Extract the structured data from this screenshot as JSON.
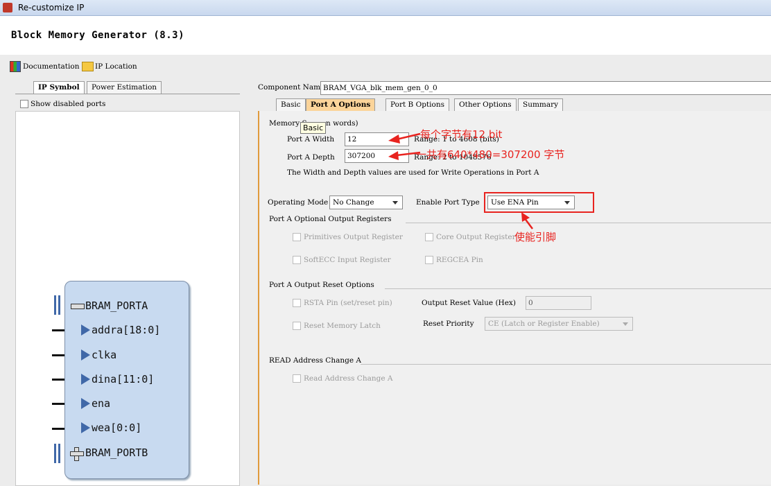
{
  "window": {
    "title": "Re-customize IP"
  },
  "header": {
    "product": "Block Memory Generator (8.3)"
  },
  "links": {
    "documentation": "Documentation",
    "ip_location": "IP Location"
  },
  "left_tabs": [
    "IP Symbol",
    "Power Estimation"
  ],
  "show_disabled": "Show disabled ports",
  "symbol": {
    "porta": "BRAM_PORTA",
    "pins": [
      "addra[18:0]",
      "clka",
      "dina[11:0]",
      "ena",
      "wea[0:0]"
    ],
    "portb": "BRAM_PORTB"
  },
  "component": {
    "label": "Component Name",
    "value": "BRAM_VGA_blk_mem_gen_0_0"
  },
  "tabs": [
    "Basic",
    "Port A Options",
    "Port B Options",
    "Other Options",
    "Summary"
  ],
  "tooltip": "Basic",
  "memory_size": {
    "title_left": "Memory S",
    "title_right": "n words)",
    "width_label": "Port A Width",
    "width_value": "12",
    "width_range": "Range: 1 to 4608 (bits)",
    "depth_label": "Port A Depth",
    "depth_value": "307200",
    "depth_range": "Range: 2 to 1048576",
    "note": "The Width and Depth values are used for Write Operations in Port A"
  },
  "operating_mode": {
    "label": "Operating Mode",
    "value": "No Change"
  },
  "enable_port": {
    "label": "Enable Port Type",
    "value": "Use ENA Pin"
  },
  "optional_regs": {
    "title": "Port A Optional Output Registers",
    "primitives": "Primitives Output Register",
    "core": "Core Output Register",
    "softecc": "SoftECC Input Register",
    "regcea": "REGCEA Pin"
  },
  "reset": {
    "title": "Port A Output Reset Options",
    "rsta": "RSTA Pin (set/reset pin)",
    "output_reset_label": "Output Reset Value (Hex)",
    "output_reset_value": "0",
    "reset_latch": "Reset Memory Latch",
    "priority_label": "Reset Priority",
    "priority_value": "CE (Latch or Register Enable)"
  },
  "read_addr": {
    "title": "READ Address Change A",
    "checkbox": "Read Address Change A"
  },
  "annotations": {
    "width_note": "每个字节有12 bit",
    "depth_note": "一共有640*480=307200 字节",
    "enable_note": "使能引脚"
  },
  "colors": {
    "annotation": "#e8231f",
    "symbol_fill": "#c8daf0",
    "active_tab": "#fbd49a"
  }
}
